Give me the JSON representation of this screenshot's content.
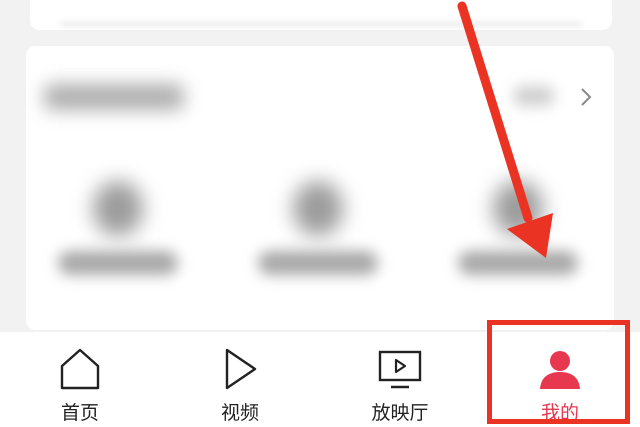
{
  "tabs": [
    {
      "label": "首页",
      "icon": "home-icon",
      "active": false
    },
    {
      "label": "视频",
      "icon": "play-icon",
      "active": false
    },
    {
      "label": "放映厅",
      "icon": "tv-icon",
      "active": false
    },
    {
      "label": "我的",
      "icon": "user-icon",
      "active": true
    }
  ],
  "colors": {
    "accent": "#e8384f",
    "annotation": "#ea3323"
  }
}
